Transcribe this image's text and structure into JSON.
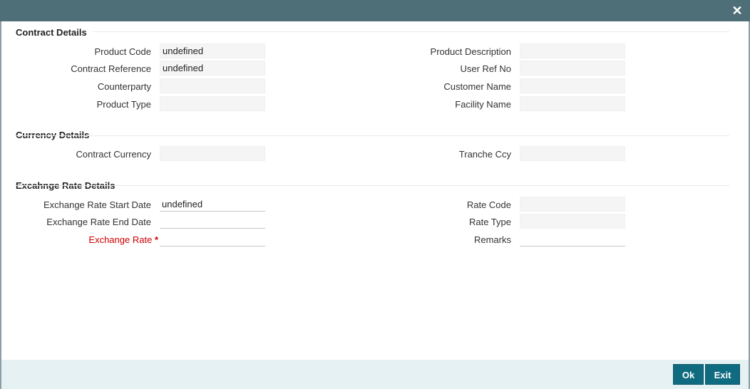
{
  "window": {
    "close_glyph": "✕"
  },
  "sections": {
    "contract": "Contract Details",
    "currency": "Currency Details",
    "exchange": "Excahnge Rate Details"
  },
  "contract": {
    "product_code": {
      "label": "Product Code",
      "value": "undefined"
    },
    "contract_reference": {
      "label": "Contract Reference",
      "value": "undefined"
    },
    "counterparty": {
      "label": "Counterparty",
      "value": ""
    },
    "product_type": {
      "label": "Product Type",
      "value": ""
    },
    "product_description": {
      "label": "Product Description",
      "value": ""
    },
    "user_ref_no": {
      "label": "User Ref No",
      "value": ""
    },
    "customer_name": {
      "label": "Customer Name",
      "value": ""
    },
    "facility_name": {
      "label": "Facility Name",
      "value": ""
    }
  },
  "currency": {
    "contract_currency": {
      "label": "Contract Currency",
      "value": ""
    },
    "tranche_ccy": {
      "label": "Tranche Ccy",
      "value": ""
    }
  },
  "exchange": {
    "start_date": {
      "label": "Exchange Rate Start Date",
      "value": "undefined"
    },
    "end_date": {
      "label": "Exchange Rate End Date",
      "value": ""
    },
    "rate": {
      "label": "Exchange Rate",
      "required_mark": "*",
      "value": ""
    },
    "rate_code": {
      "label": "Rate Code",
      "value": ""
    },
    "rate_type": {
      "label": "Rate Type",
      "value": ""
    },
    "remarks": {
      "label": "Remarks",
      "value": ""
    }
  },
  "footer": {
    "ok_label": "Ok",
    "exit_label": "Exit"
  },
  "colors": {
    "titlebar": "#4e6e78",
    "button": "#0f6b80",
    "required": "#cc0000",
    "footer": "#e6f1f3"
  }
}
